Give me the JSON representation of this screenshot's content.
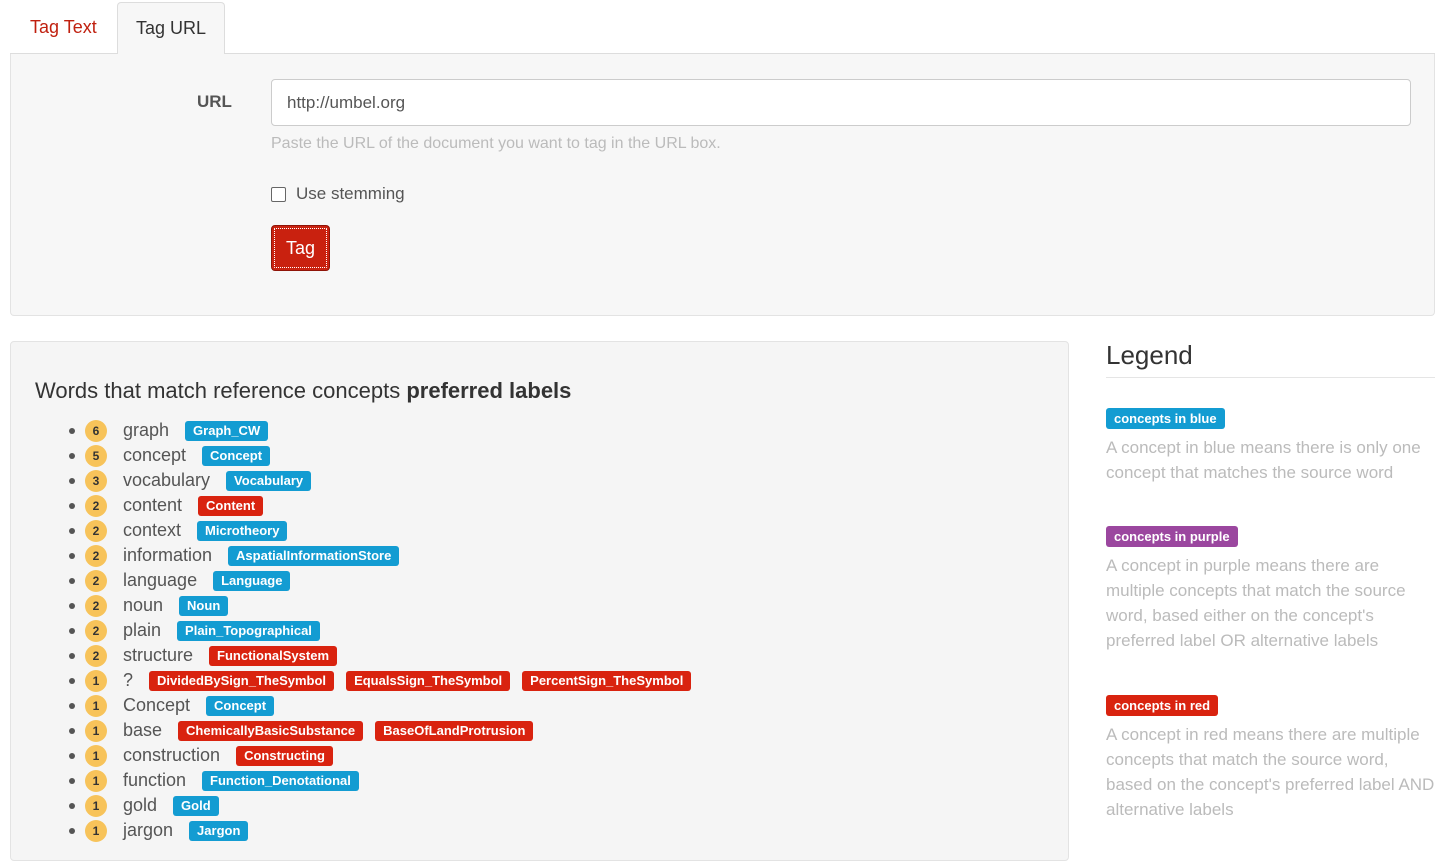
{
  "tabs": [
    {
      "label": "Tag Text",
      "active": false
    },
    {
      "label": "Tag URL",
      "active": true
    }
  ],
  "form": {
    "url_label": "URL",
    "url_value": "http://umbel.org",
    "help_text": "Paste the URL of the document you want to tag in the URL box.",
    "stemming_label": "Use stemming",
    "stemming_checked": false,
    "tag_button": "Tag"
  },
  "results": {
    "title_prefix": "Words that match reference concepts ",
    "title_bold": "preferred labels",
    "items": [
      {
        "count": "6",
        "word": "graph",
        "concepts": [
          {
            "label": "Graph_CW",
            "color": "blue"
          }
        ]
      },
      {
        "count": "5",
        "word": "concept",
        "concepts": [
          {
            "label": "Concept",
            "color": "blue"
          }
        ]
      },
      {
        "count": "3",
        "word": "vocabulary",
        "concepts": [
          {
            "label": "Vocabulary",
            "color": "blue"
          }
        ]
      },
      {
        "count": "2",
        "word": "content",
        "concepts": [
          {
            "label": "Content",
            "color": "red"
          }
        ]
      },
      {
        "count": "2",
        "word": "context",
        "concepts": [
          {
            "label": "Microtheory",
            "color": "blue"
          }
        ]
      },
      {
        "count": "2",
        "word": "information",
        "concepts": [
          {
            "label": "AspatialInformationStore",
            "color": "blue"
          }
        ]
      },
      {
        "count": "2",
        "word": "language",
        "concepts": [
          {
            "label": "Language",
            "color": "blue"
          }
        ]
      },
      {
        "count": "2",
        "word": "noun",
        "concepts": [
          {
            "label": "Noun",
            "color": "blue"
          }
        ]
      },
      {
        "count": "2",
        "word": "plain",
        "concepts": [
          {
            "label": "Plain_Topographical",
            "color": "blue"
          }
        ]
      },
      {
        "count": "2",
        "word": "structure",
        "concepts": [
          {
            "label": "FunctionalSystem",
            "color": "red"
          }
        ]
      },
      {
        "count": "1",
        "word": "?",
        "concepts": [
          {
            "label": "DividedBySign_TheSymbol",
            "color": "red"
          },
          {
            "label": "EqualsSign_TheSymbol",
            "color": "red"
          },
          {
            "label": "PercentSign_TheSymbol",
            "color": "red"
          }
        ]
      },
      {
        "count": "1",
        "word": "Concept",
        "concepts": [
          {
            "label": "Concept",
            "color": "blue"
          }
        ]
      },
      {
        "count": "1",
        "word": "base",
        "concepts": [
          {
            "label": "ChemicallyBasicSubstance",
            "color": "red"
          },
          {
            "label": "BaseOfLandProtrusion",
            "color": "red"
          }
        ]
      },
      {
        "count": "1",
        "word": "construction",
        "concepts": [
          {
            "label": "Constructing",
            "color": "red"
          }
        ]
      },
      {
        "count": "1",
        "word": "function",
        "concepts": [
          {
            "label": "Function_Denotational",
            "color": "blue"
          }
        ]
      },
      {
        "count": "1",
        "word": "gold",
        "concepts": [
          {
            "label": "Gold",
            "color": "blue"
          }
        ]
      },
      {
        "count": "1",
        "word": "jargon",
        "concepts": [
          {
            "label": "Jargon",
            "color": "blue"
          }
        ]
      }
    ]
  },
  "legend": {
    "title": "Legend",
    "entries": [
      {
        "badge": "concepts in blue",
        "color": "blue",
        "description": "A concept in blue means there is only one concept that matches the source word"
      },
      {
        "badge": "concepts in purple",
        "color": "purple",
        "description": "A concept in purple means there are multiple concepts that match the source word, based either on the concept's preferred label OR alternative labels"
      },
      {
        "badge": "concepts in red",
        "color": "red",
        "description": "A concept in red means there are multiple concepts that match the source word, based on the concept's preferred label AND alternative labels"
      }
    ]
  },
  "colors": {
    "blue": "#139cd2",
    "purple": "#9b479f",
    "red": "#d9230f",
    "count_badge": "#f7c35a",
    "accent": "#c9210f"
  }
}
